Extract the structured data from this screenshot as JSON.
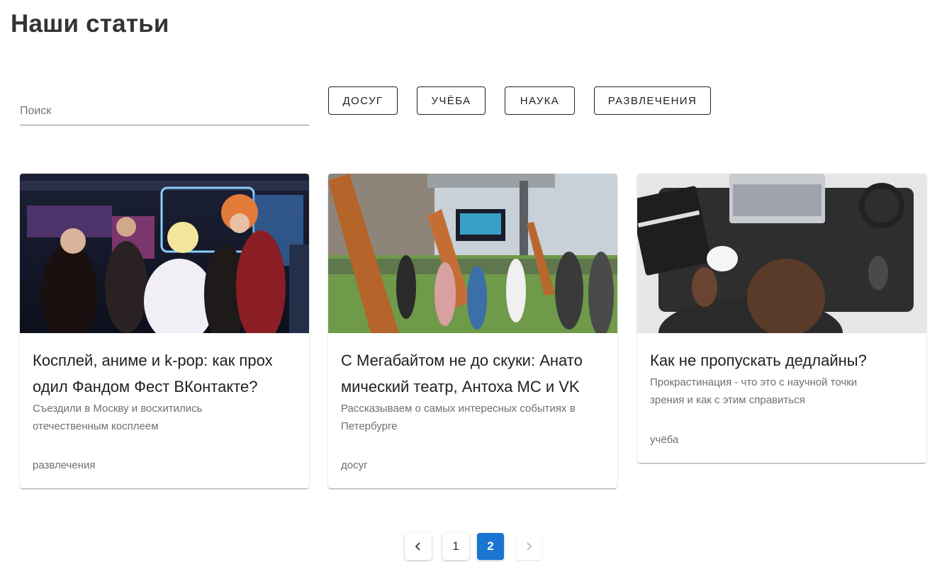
{
  "page": {
    "title": "Наши статьи"
  },
  "search": {
    "placeholder": "Поиск",
    "value": ""
  },
  "filters": [
    "ДОСУГ",
    "УЧЁБА",
    "НАУКА",
    "РАЗВЛЕЧЕНИЯ"
  ],
  "articles": [
    {
      "title": "Косплей, аниме и k-pop: как прох\nодил Фандом Фест ВКонтакте?",
      "description": "Съездили в Москву и восхитились\nотечественным косплеем",
      "tag": "развлечения"
    },
    {
      "title": "С Мегабайтом не до скуки: Анато\nмический театр, Антоха МС и VK",
      "description": "Рассказываем о самых интересных событиях в\nПетербурге",
      "tag": "досуг"
    },
    {
      "title": "Как не пропускать дедлайны?",
      "description": "Прокрастинация - что это с научной точки\nзрения и как с этим справиться",
      "tag": "учёба"
    }
  ],
  "pagination": {
    "pages": [
      "1",
      "2"
    ],
    "current": "2",
    "prev_icon": "chevron-left-icon",
    "next_icon": "chevron-right-icon",
    "accent": "#1976d2"
  }
}
